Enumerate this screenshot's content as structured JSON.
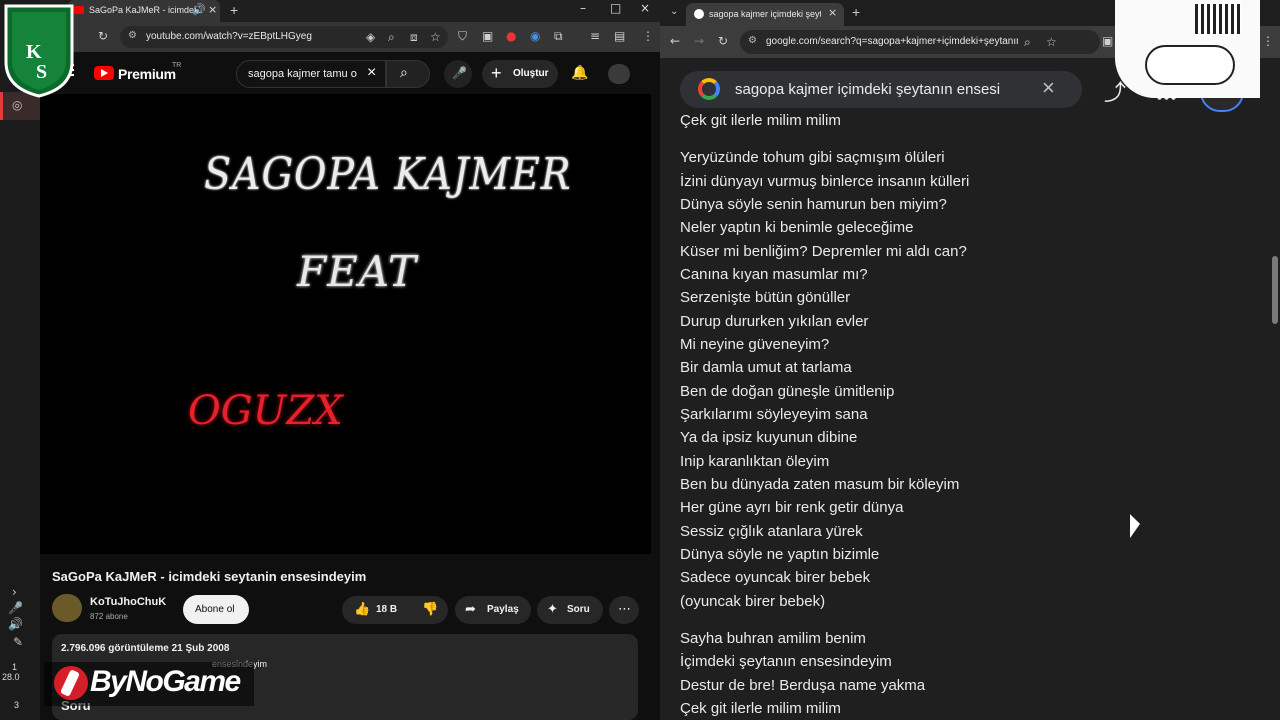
{
  "taskbar": {
    "icons": [
      "club-logo",
      "chrome-icon",
      "chevron-up-icon",
      "mic-icon",
      "volume-icon",
      "pen-icon"
    ],
    "time_fragment": "1",
    "date_fragment": "28.0",
    "badge": "3"
  },
  "left_browser": {
    "tab_title": "SaGoPa KaJMeR - icimdeki",
    "url": "youtube.com/watch?v=zEBptLHGyeg",
    "youtube": {
      "brand": "Premium",
      "country": "TR",
      "search_value": "sagopa kajmer tamu o",
      "create_label": "Oluştur"
    },
    "video_overlay": {
      "line1": "SAGOPA KAJMER",
      "line2": "FEAT",
      "line3": "OGUZX"
    },
    "video_title": "SaGoPa KaJMeR - icimdeki seytanin ensesindeyim",
    "channel": {
      "name": "KoTuJhoChuK",
      "subscribers": "872 abone",
      "subscribe_label": "Abone ol"
    },
    "actions": {
      "likes": "18 B",
      "share_label": "Paylaş",
      "ask_label": "Soru"
    },
    "description": {
      "meta": "2.796.096 görüntüleme  21 Şub 2008",
      "line": "ensesindeyim",
      "question_label": "Soru"
    },
    "watermark": "ByNoGame"
  },
  "right_browser": {
    "tab_title": "sagopa kajmer içimdeki şeytan",
    "url": "google.com/search?q=sagopa+kajmer+içimdeki+şeytanın...",
    "search_value": "sagopa kajmer içimdeki şeytanın ensesi",
    "lyrics": [
      "Çek git ilerle milim milim",
      "Yeryüzünde tohum gibi saçmışım ölüleri",
      "İzini dünyayı vurmuş binlerce insanın külleri",
      "Dünya söyle senin hamurun ben miyim?",
      "Neler yaptın ki benimle geleceğime",
      "Küser mi benliğim? Depremler mi aldı can?",
      "Canına kıyan masumlar mı?",
      "Serzenişte bütün gönüller",
      "Durup dururken yıkılan evler",
      "Mi neyine güveneyim?",
      "Bir damla umut at tarlama",
      "Ben de doğan güneşle ümitlenip",
      "Şarkılarımı söyleyeyim sana",
      "Ya da ipsiz kuyunun dibine",
      "Inip karanlıktan öleyim",
      "Ben bu dünyada zaten masum bir köleyim",
      "Her güne ayrı bir renk getir dünya",
      "Sessiz çığlık atanlara yürek",
      "Dünya söyle ne yaptın bizimle",
      "Sadece oyuncak birer bebek",
      "(oyuncak birer bebek)",
      "Sayha buhran amilim benim",
      "İçimdeki şeytanın ensesindeyim",
      "Destur de bre! Berduşa name yakma",
      "Çek git ilerle milim milim"
    ]
  }
}
